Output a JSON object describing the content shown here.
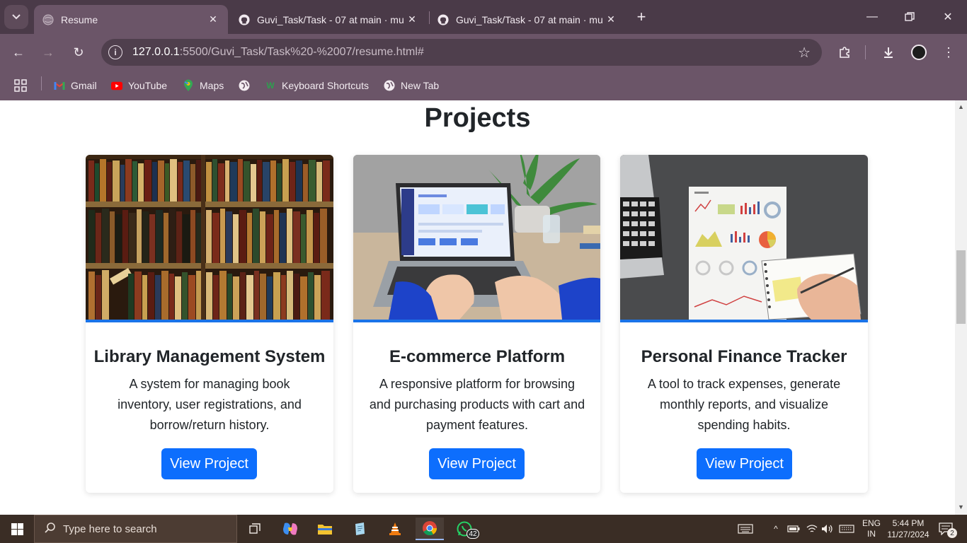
{
  "browser": {
    "tabs": [
      {
        "title": "Resume",
        "active": true,
        "favicon": "globe-icon"
      },
      {
        "title": "Guvi_Task/Task - 07 at main · mu",
        "active": false,
        "favicon": "github-icon"
      },
      {
        "title": "Guvi_Task/Task - 07 at main · mu",
        "active": false,
        "favicon": "github-icon"
      }
    ],
    "url_host": "127.0.0.1",
    "url_rest": ":5500/Guvi_Task/Task%20-%2007/resume.html#",
    "bookmarks": [
      {
        "label": "Gmail",
        "icon": "gmail-icon"
      },
      {
        "label": "YouTube",
        "icon": "youtube-icon"
      },
      {
        "label": "Maps",
        "icon": "maps-icon"
      },
      {
        "label": "",
        "icon": "globe-icon"
      },
      {
        "label": "Keyboard Shortcuts",
        "icon": "keyboard-shortcuts-icon"
      },
      {
        "label": "New Tab",
        "icon": "globe-icon"
      }
    ]
  },
  "page": {
    "section_title": "Projects",
    "projects": [
      {
        "title": "Library Management System",
        "description": "A system for managing book inventory, user registrations, and borrow/return history.",
        "button": "View Project",
        "image": "bookshelf-photo"
      },
      {
        "title": "E-commerce Platform",
        "description": "A responsive platform for browsing and purchasing products with cart and payment features.",
        "button": "View Project",
        "image": "laptop-dashboard-photo"
      },
      {
        "title": "Personal Finance Tracker",
        "description": "A tool to track expenses, generate monthly reports, and visualize spending habits.",
        "button": "View Project",
        "image": "finance-report-photo"
      }
    ]
  },
  "taskbar": {
    "search_placeholder": "Type here to search",
    "whatsapp_badge": "42",
    "language_line1": "ENG",
    "language_line2": "IN",
    "time": "5:44 PM",
    "date": "11/27/2024",
    "notification_count": "2"
  },
  "colors": {
    "accent_button": "#0d6efd",
    "card_divider": "#1a73e8",
    "chrome_frame": "#6b5568"
  }
}
